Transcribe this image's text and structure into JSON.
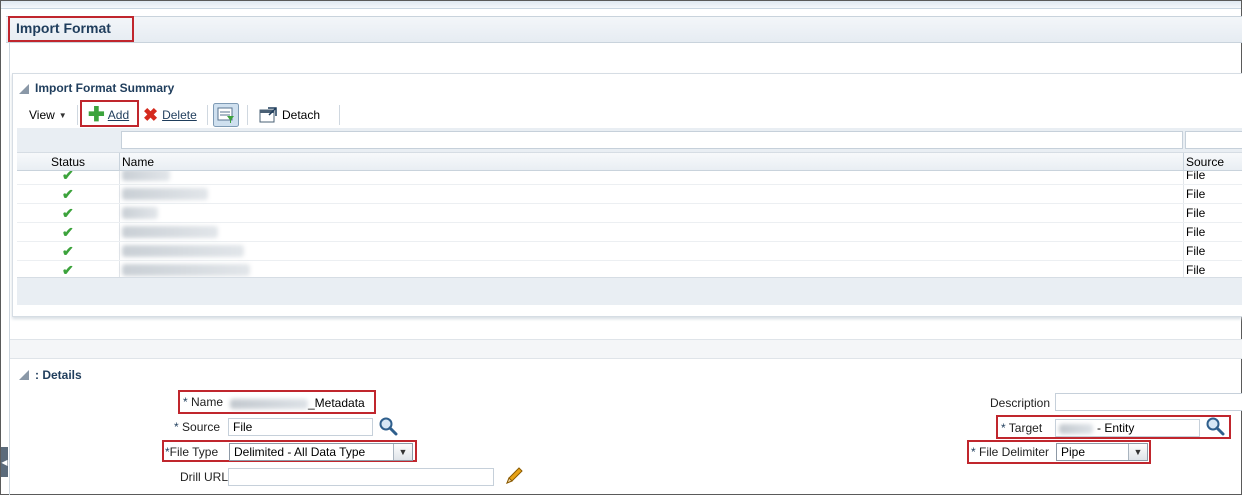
{
  "page": {
    "title": "Import Format"
  },
  "summary": {
    "title": "Import Format Summary",
    "toolbar": {
      "view_label": "View",
      "add_label": "Add",
      "delete_label": "Delete",
      "detach_label": "Detach"
    },
    "columns": {
      "status": "Status",
      "name": "Name",
      "source": "Source"
    },
    "rows": [
      {
        "status": "ok",
        "source": "File"
      },
      {
        "status": "ok",
        "source": "File"
      },
      {
        "status": "ok",
        "source": "File"
      },
      {
        "status": "ok",
        "source": "File"
      },
      {
        "status": "ok",
        "source": "File"
      },
      {
        "status": "ok",
        "source": "File"
      }
    ]
  },
  "details": {
    "title": ": Details",
    "name_label": "Name",
    "name_value_suffix": "_Metadata",
    "source_label": "Source",
    "source_value": "File",
    "file_type_label": "File Type",
    "file_type_value": "Delimited - All Data Type",
    "drill_url_label": "Drill URL",
    "description_label": "Description",
    "target_label": "Target",
    "target_value_suffix": "- Entity",
    "file_delimiter_label": "File Delimiter",
    "file_delimiter_value": "Pipe",
    "required_marker": "*"
  },
  "colors": {
    "accent": "#1f3d5c",
    "highlight_box": "#c0262d",
    "check": "#3ca33c"
  }
}
